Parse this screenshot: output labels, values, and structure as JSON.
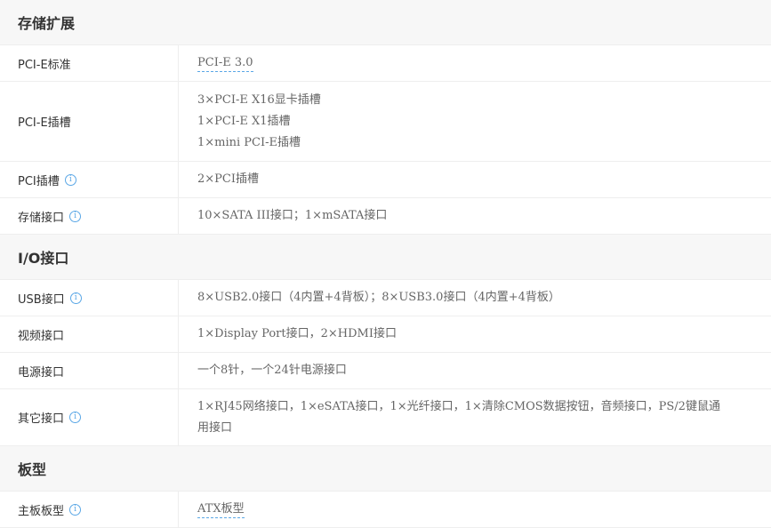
{
  "sections": [
    {
      "title": "存储扩展",
      "rows": [
        {
          "label": "PCI-E标准",
          "info": false,
          "lines": [
            "PCI-E 3.0"
          ],
          "link": true
        },
        {
          "label": "PCI-E插槽",
          "info": false,
          "lines": [
            "3×PCI-E X16显卡插槽",
            "1×PCI-E X1插槽",
            "1×mini PCI-E插槽"
          ],
          "link": false
        },
        {
          "label": "PCI插槽",
          "info": true,
          "lines": [
            "2×PCI插槽"
          ],
          "link": false
        },
        {
          "label": "存储接口",
          "info": true,
          "lines": [
            "10×SATA III接口；1×mSATA接口"
          ],
          "link": false
        }
      ]
    },
    {
      "title": "I/O接口",
      "rows": [
        {
          "label": "USB接口",
          "info": true,
          "lines": [
            "8×USB2.0接口（4内置+4背板）；8×USB3.0接口（4内置+4背板）"
          ],
          "link": false
        },
        {
          "label": "视频接口",
          "info": false,
          "lines": [
            "1×Display Port接口，2×HDMI接口"
          ],
          "link": false
        },
        {
          "label": "电源接口",
          "info": false,
          "lines": [
            "一个8针，一个24针电源接口"
          ],
          "link": false
        },
        {
          "label": "其它接口",
          "info": true,
          "lines": [
            "1×RJ45网络接口，1×eSATA接口，1×光纤接口，1×清除CMOS数据按钮，音频接口，PS/2键鼠通",
            "用接口"
          ],
          "link": false
        }
      ]
    },
    {
      "title": "板型",
      "rows": [
        {
          "label": "主板板型",
          "info": true,
          "lines": [
            "ATX板型"
          ],
          "link": true
        }
      ]
    }
  ],
  "info_icon_glyph": "i"
}
